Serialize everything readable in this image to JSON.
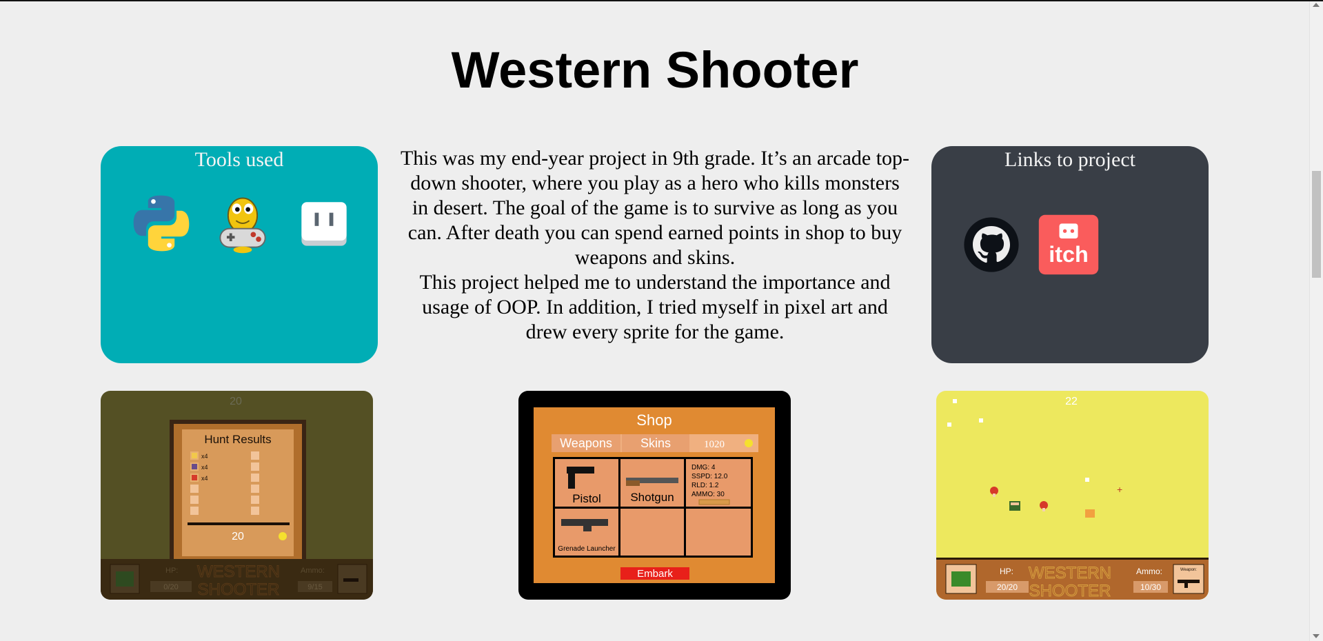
{
  "page": {
    "title": "Western Shooter"
  },
  "tools_card": {
    "title": "Tools used",
    "icons": [
      "python-icon",
      "pygame-icon",
      "pixel-editor-icon"
    ],
    "color": "#00adb5"
  },
  "description": {
    "paragraph1": "This was my end-year project in 9th grade. It’s an arcade top-down shooter, where you play as a hero who kills monsters in desert. The goal of the game is to survive as long as you can. After death you can spend earned points in shop to buy weapons and skins.",
    "paragraph2": "This project helped me to understand the importance and usage of OOP. In addition, I tried myself in pixel art and drew every sprite for the game."
  },
  "links_card": {
    "title": "Links to project",
    "icons": [
      "github-icon",
      "itch-icon"
    ],
    "itch_label": "itch",
    "color": "#393e46"
  },
  "screenshots": {
    "hunt": {
      "score_top": "20",
      "title": "Hunt Results",
      "count1": "x4",
      "count2": "x4",
      "count3": "x4",
      "total": "20",
      "hp_label": "HP:",
      "hp_value": "0/20",
      "ammo_label": "Ammo:",
      "ammo_value": "9/15",
      "logo_line1": "WESTERN",
      "logo_line2": "SHOOTER"
    },
    "shop": {
      "title": "Shop",
      "tab_weapons": "Weapons",
      "tab_skins": "Skins",
      "coins": "1020",
      "item1": "Pistol",
      "item2": "Shotgun",
      "stat1": "DMG: 4",
      "stat2": "SSPD: 12.0",
      "stat3": "RLD: 1.2",
      "stat4": "AMMO: 30",
      "item4": "Grenade Launcher",
      "embark": "Embark"
    },
    "gameplay": {
      "score_top": "22",
      "hp_label": "HP:",
      "hp_value": "20/20",
      "ammo_label": "Ammo:",
      "ammo_value": "10/30",
      "weapon_label": "Weapon:",
      "logo_line1": "WESTERN",
      "logo_line2": "SHOOTER"
    }
  }
}
